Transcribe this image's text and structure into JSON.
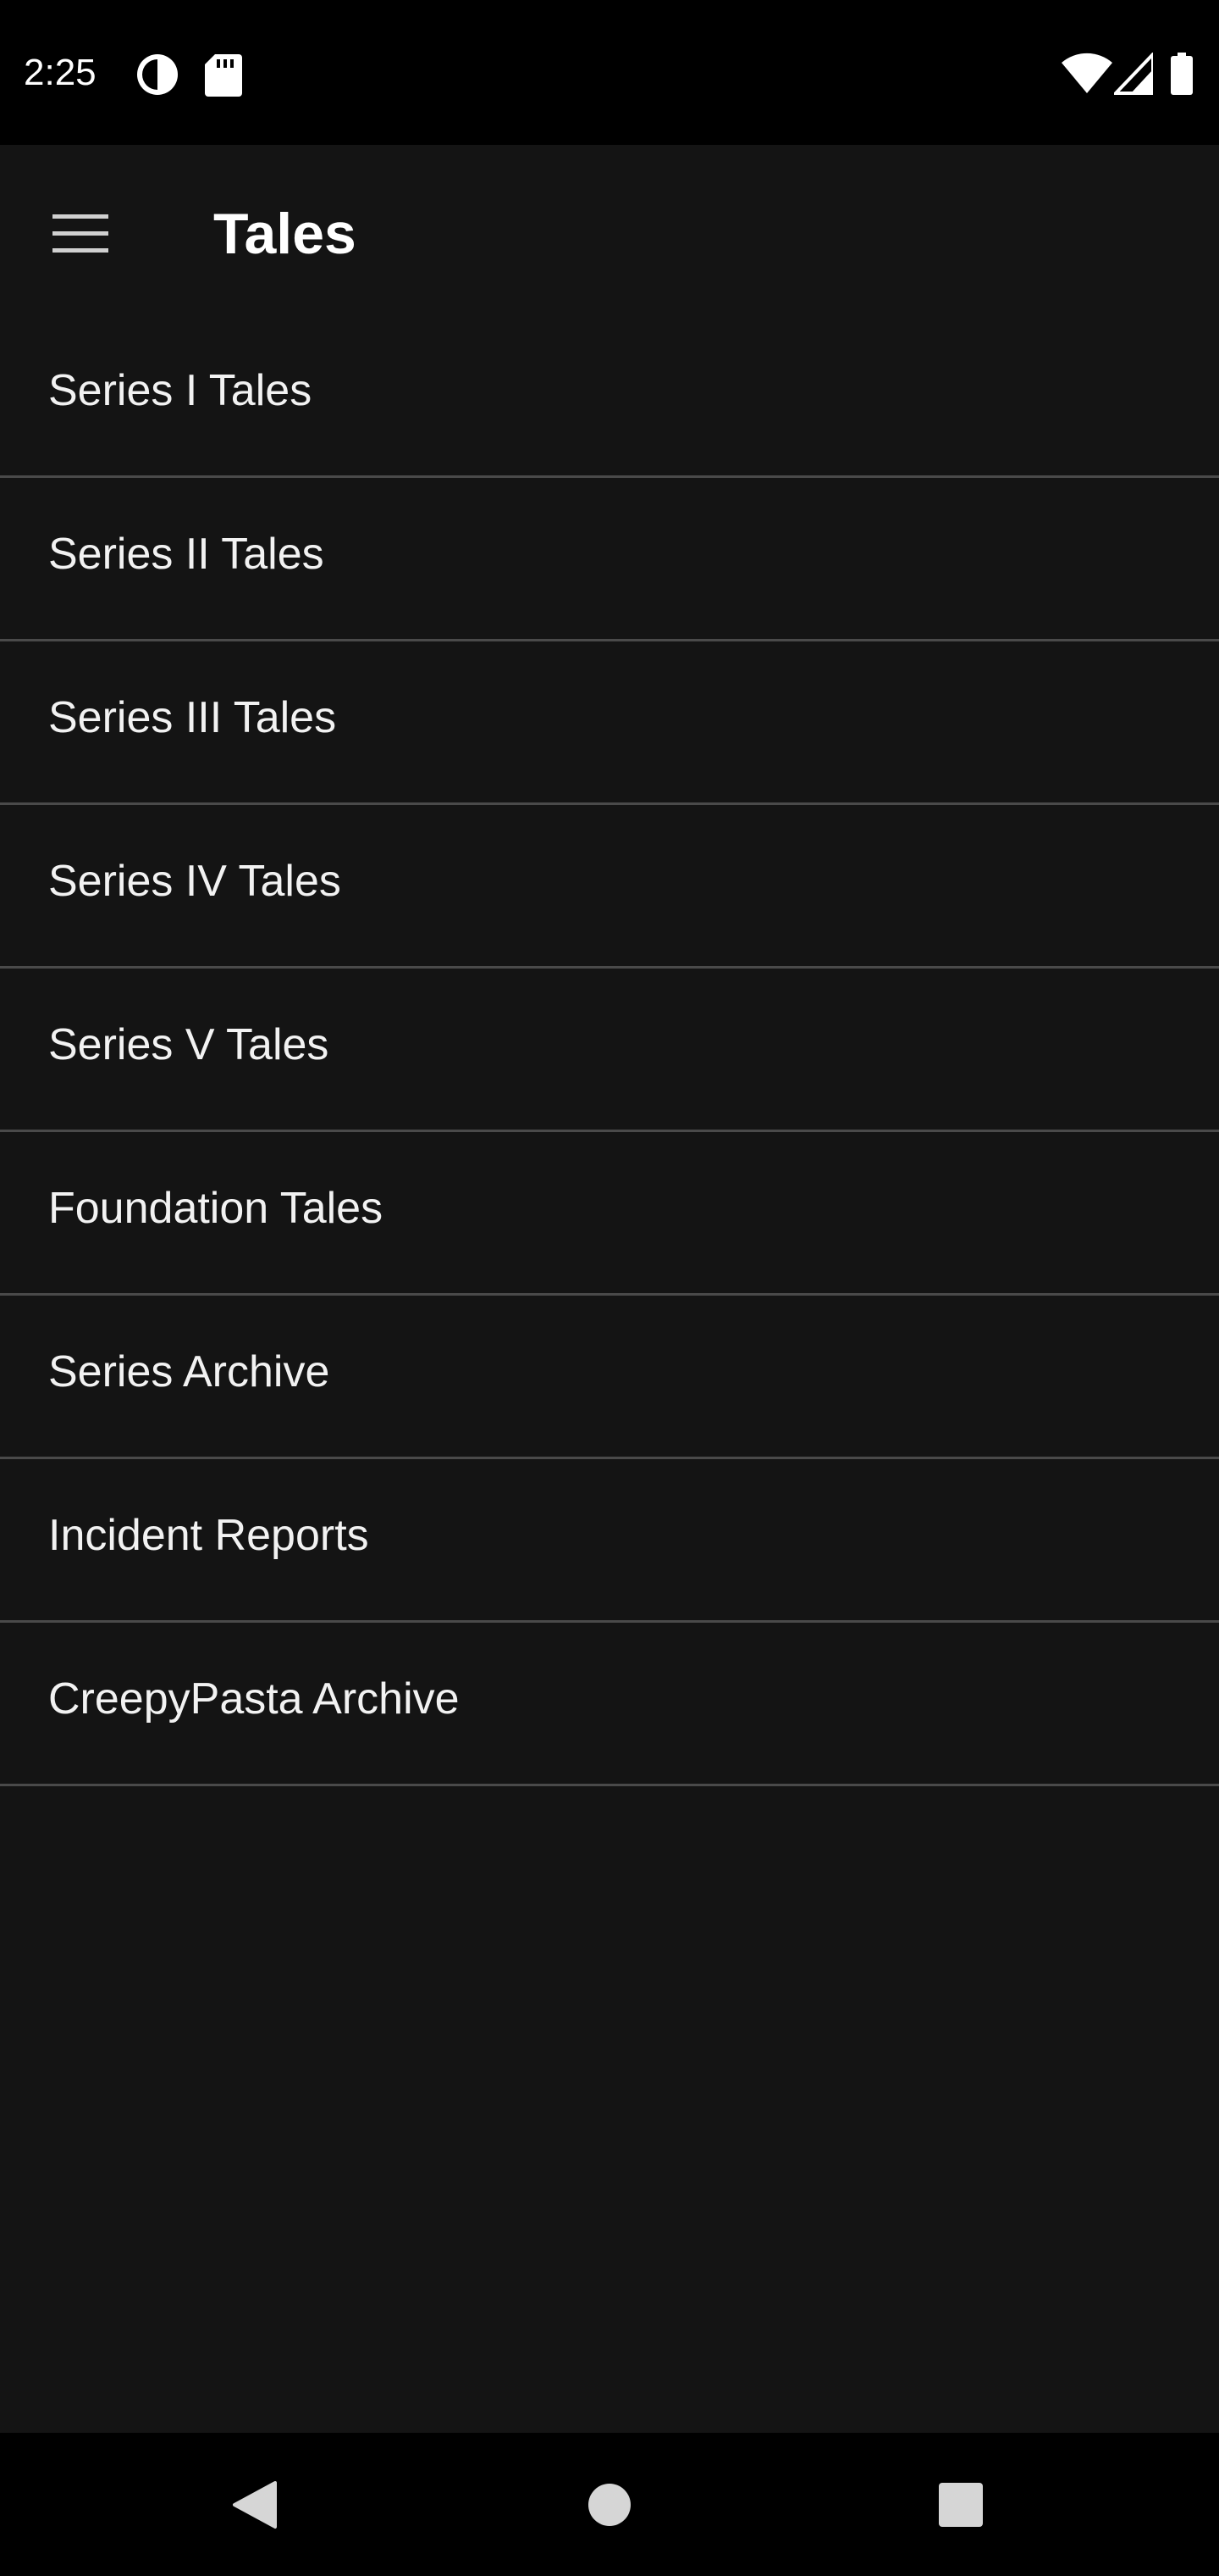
{
  "status_bar": {
    "time": "2:25",
    "left_icons": [
      "app-notification-icon",
      "sd-card-icon"
    ],
    "right_icons": [
      "wifi-icon",
      "cell-signal-icon",
      "battery-icon"
    ]
  },
  "toolbar": {
    "menu_icon": "hamburger-menu-icon",
    "title": "Tales"
  },
  "list": {
    "items": [
      {
        "label": "Series I Tales"
      },
      {
        "label": "Series II Tales"
      },
      {
        "label": "Series III Tales"
      },
      {
        "label": "Series IV Tales"
      },
      {
        "label": "Series V Tales"
      },
      {
        "label": "Foundation Tales"
      },
      {
        "label": "Series Archive"
      },
      {
        "label": "Incident Reports"
      },
      {
        "label": "CreepyPasta Archive"
      }
    ]
  },
  "nav_bar": {
    "buttons": [
      "back-icon",
      "home-icon",
      "recents-icon"
    ]
  },
  "colors": {
    "background": "#141414",
    "system_bars": "#000000",
    "divider": "#4a4a4a",
    "text": "#f2f2f2"
  }
}
